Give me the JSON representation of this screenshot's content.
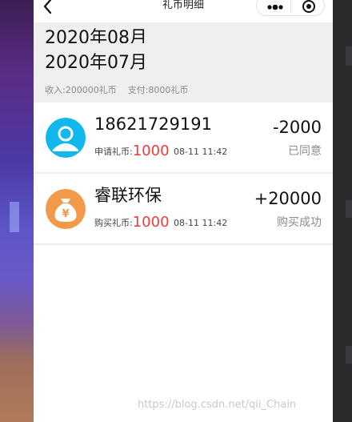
{
  "nav": {
    "title": "礼币明细",
    "back_icon": "back-arrow-icon",
    "more_icon": "more-dots-icon",
    "close_icon": "target-close-icon"
  },
  "header": {
    "prev_month": "2020年08月",
    "current_month": "2020年07月",
    "income": "收入:200000礼币",
    "expense": "支付:8000礼币"
  },
  "records": [
    {
      "name": "18621729191",
      "meta_label": "申请礼币:",
      "coins": "1000",
      "time": "08-11 11:42",
      "amount": "-2000",
      "status": "已同意",
      "icon": "user-avatar-icon",
      "color": "#11b8ec"
    },
    {
      "name": "睿联环保",
      "meta_label": "购买礼币:",
      "coins": "1000",
      "time": "08-11 11:42",
      "amount": "+20000",
      "status": "购买成功",
      "icon": "money-bag-icon",
      "color": "#f39a4a"
    }
  ],
  "watermark": "https://blog.csdn.net/qii_Chain",
  "colors": {
    "accent_red": "#ef3b3b",
    "header_bg": "#efefef"
  }
}
